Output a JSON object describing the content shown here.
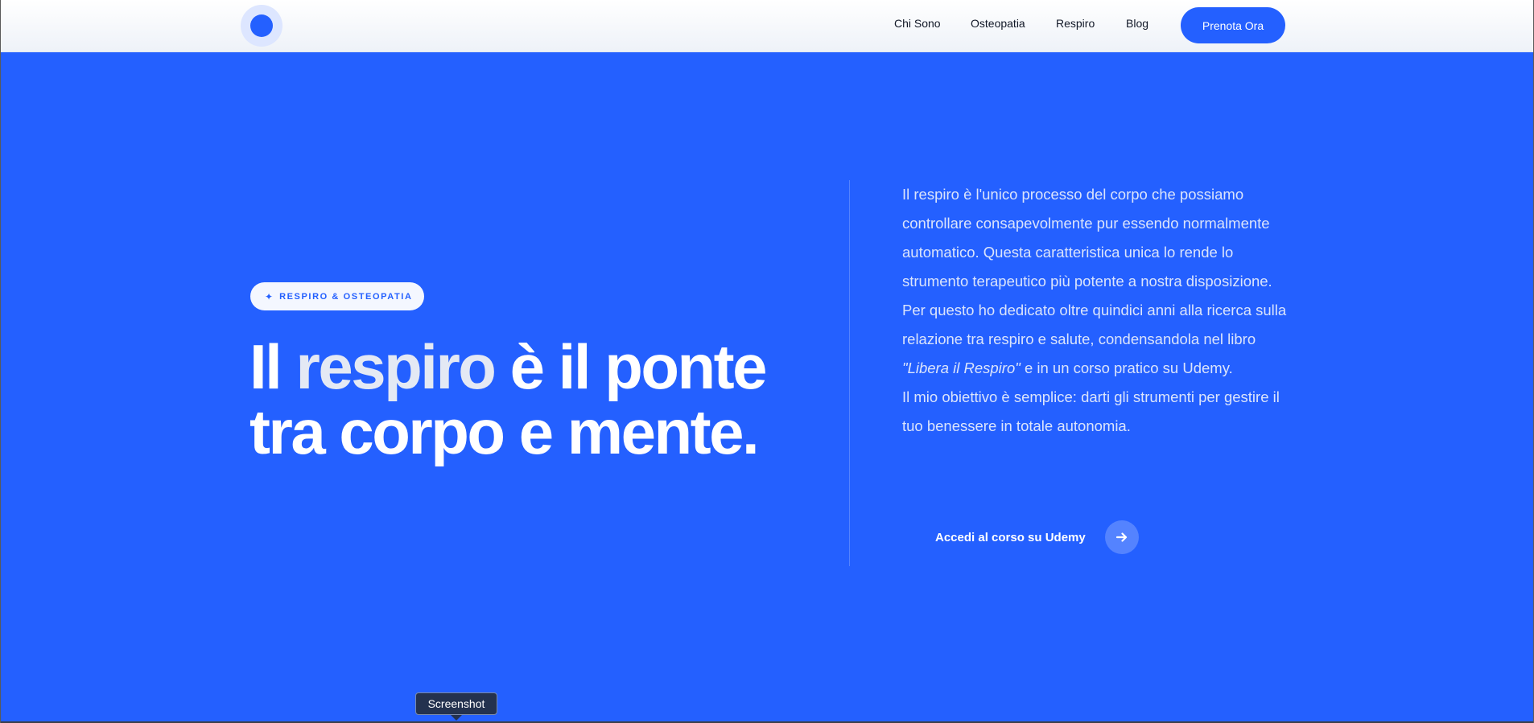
{
  "navbar": {
    "links": [
      "Chi Sono",
      "Osteopatia",
      "Respiro",
      "Blog"
    ],
    "cta_label": "Prenota Ora"
  },
  "hero": {
    "badge_text": "RESPIRO & OSTEOPATIA",
    "headline": {
      "part1": "Il ",
      "part2": "respiro",
      "part3": " è il ponte tra corpo e mente."
    },
    "paragraph1": "Il respiro è l'unico processo del corpo che possiamo controllare consapevolmente pur essendo normalmente automatico. Questa caratteristica unica lo rende lo strumento terapeutico più potente a nostra disposizione.",
    "paragraph2": {
      "before": "Per questo ho dedicato oltre quindici anni alla ricerca sulla relazione tra respiro e salute, condensandola nel libro ",
      "book_title": "\"Libera il Respiro\"",
      "after": " e in un corso pratico su Udemy."
    },
    "paragraph3": "Il mio obiettivo è semplice: darti gli strumenti per gestire il tuo benessere in totale autonomia.",
    "cta_label": "Accedi al corso su Udemy"
  },
  "tooltip": {
    "text": "Screenshot"
  },
  "colors": {
    "brand_blue": "#2460ff",
    "navbar_bg": "#ffffff",
    "tooltip_bg": "#24324f"
  },
  "icons": {
    "badge": "sparkle-icon",
    "cta": "arrow-right-icon"
  }
}
